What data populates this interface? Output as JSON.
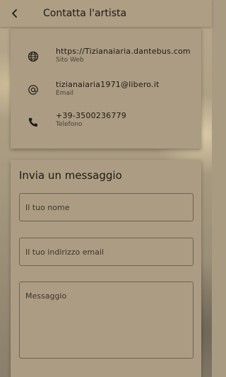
{
  "header": {
    "title": "Contatta l'artista"
  },
  "contacts": [
    {
      "icon": "globe-icon",
      "value": "https://Tizianaiaria.dantebus.com",
      "label": "Sito Web"
    },
    {
      "icon": "at-icon",
      "value": "tizianaiaria1971@libero.it",
      "label": "Email"
    },
    {
      "icon": "phone-icon",
      "value": "+39-3500236779",
      "label": "Telefono"
    }
  ],
  "form": {
    "title": "Invia un messaggio",
    "name_placeholder": "Il tuo nome",
    "email_placeholder": "Il tuo indirizzo email",
    "message_placeholder": "Messaggio"
  },
  "colors": {
    "appbar": "#ad9e84",
    "card": "#ab9c83",
    "text": "#1f1a14"
  }
}
